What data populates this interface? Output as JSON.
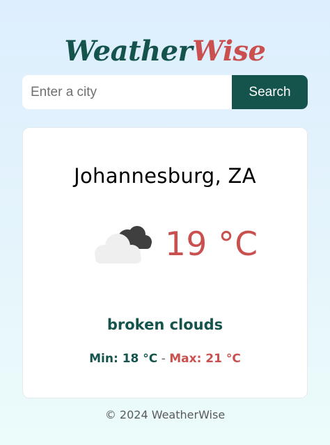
{
  "app": {
    "logo_part1": "Weather",
    "logo_part2": "Wise",
    "colors": {
      "primary": "#15544d",
      "accent": "#c9504f"
    }
  },
  "search": {
    "placeholder": "Enter a city",
    "value": "",
    "button_label": "Search"
  },
  "weather": {
    "location": "Johannesburg, ZA",
    "icon": "broken-clouds-icon",
    "temperature": "19 °C",
    "description": "broken clouds",
    "min_label": "Min: 18 °C",
    "separator": " - ",
    "max_label": "Max: 21 °C"
  },
  "footer": {
    "copyright": "© 2024 WeatherWise"
  }
}
